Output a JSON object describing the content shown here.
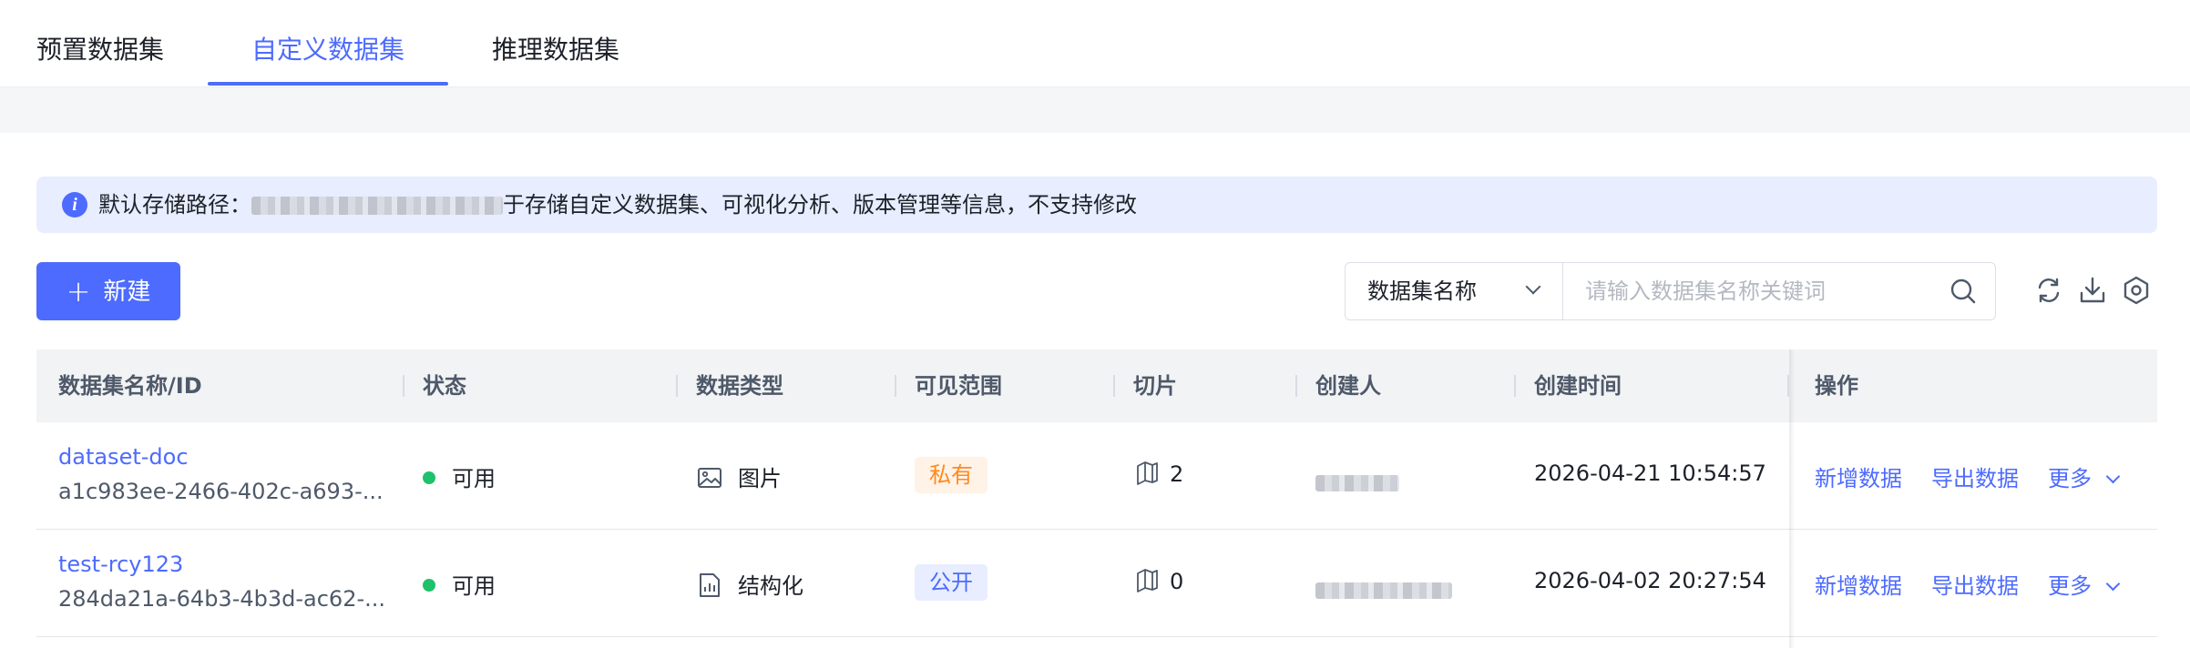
{
  "tabs": [
    {
      "label": "预置数据集",
      "active": false
    },
    {
      "label": "自定义数据集",
      "active": true
    },
    {
      "label": "推理数据集",
      "active": false
    }
  ],
  "banner": {
    "icon": "info-icon",
    "prefix": "默认存储路径：",
    "suffix": "于存储自定义数据集、可视化分析、版本管理等信息，不支持修改"
  },
  "toolbar": {
    "new_label": "新建",
    "select_value": "数据集名称",
    "search_placeholder": "请输入数据集名称关键词"
  },
  "table": {
    "columns": [
      "数据集名称/ID",
      "状态",
      "数据类型",
      "可见范围",
      "切片",
      "创建人",
      "创建时间",
      "操作"
    ],
    "rows": [
      {
        "name": "dataset-doc",
        "id": "a1c983ee-2466-402c-a693-...",
        "status": "可用",
        "type": "图片",
        "type_icon": "image-icon",
        "visibility": "私有",
        "slices": "2",
        "created_at": "2026-04-21 10:54:57",
        "actions": [
          "新增数据",
          "导出数据",
          "更多"
        ]
      },
      {
        "name": "test-rcy123",
        "id": "284da21a-64b3-4b3d-ac62-...",
        "status": "可用",
        "type": "结构化",
        "type_icon": "structured-data-icon",
        "visibility": "公开",
        "slices": "0",
        "created_at": "2026-04-02 20:27:54",
        "actions": [
          "新增数据",
          "导出数据",
          "更多"
        ]
      }
    ]
  },
  "colors": {
    "accent": "#4d6bfe",
    "status_ok": "#1fc16b",
    "private_tag": "#ff8a1f",
    "banner_bg": "#e8edff"
  }
}
